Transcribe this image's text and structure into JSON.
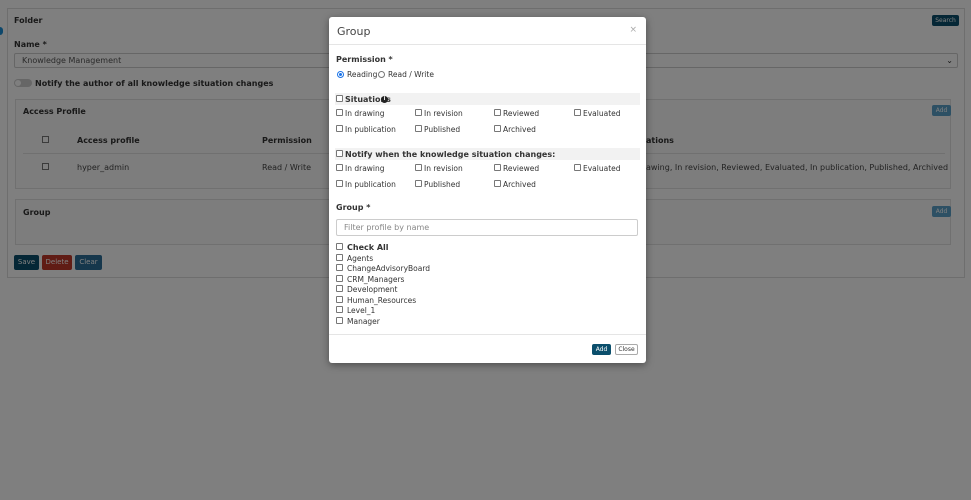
{
  "background": {
    "folder_title": "Folder",
    "search_label": "Search",
    "name_label": "Name *",
    "name_value": "Knowledge Management",
    "notify_author_label": "Notify the author of all knowledge situation changes",
    "access_profile": {
      "title": "Access Profile",
      "add_label": "Add",
      "headers": [
        "Access profile",
        "Permission",
        "ations"
      ],
      "row": {
        "profile": "hyper_admin",
        "permission": "Read / Write",
        "situations": "awing, In revision, Reviewed, Evaluated, In publication, Published, Archived"
      }
    },
    "group": {
      "title": "Group",
      "add_label": "Add"
    },
    "buttons": {
      "save": "Save",
      "delete": "Delete",
      "clear": "Clear"
    }
  },
  "modal": {
    "title": "Group",
    "close_glyph": "×",
    "permission_label": "Permission *",
    "permission_options": [
      "Reading",
      "Read / Write"
    ],
    "permission_selected": "Reading",
    "situations_label": "Situations",
    "situations": [
      "In drawing",
      "In revision",
      "Reviewed",
      "Evaluated",
      "In publication",
      "Published",
      "Archived"
    ],
    "notify_label": "Notify when the knowledge situation changes:",
    "notify_situations": [
      "In drawing",
      "In revision",
      "Reviewed",
      "Evaluated",
      "In publication",
      "Published",
      "Archived"
    ],
    "group_label": "Group *",
    "filter_placeholder": "Filter profile by name",
    "check_all_label": "Check All",
    "groups": [
      "Agents",
      "ChangeAdvisoryBoard",
      "CRM_Managers",
      "Development",
      "Human_Resources",
      "Level_1",
      "Manager"
    ],
    "add_label": "Add",
    "close_label": "Close"
  },
  "colors": {
    "primary": "#0b4f6c",
    "danger": "#c0392b",
    "secondary": "#2c6e99",
    "overlay": "rgba(0,0,0,0.5)"
  }
}
